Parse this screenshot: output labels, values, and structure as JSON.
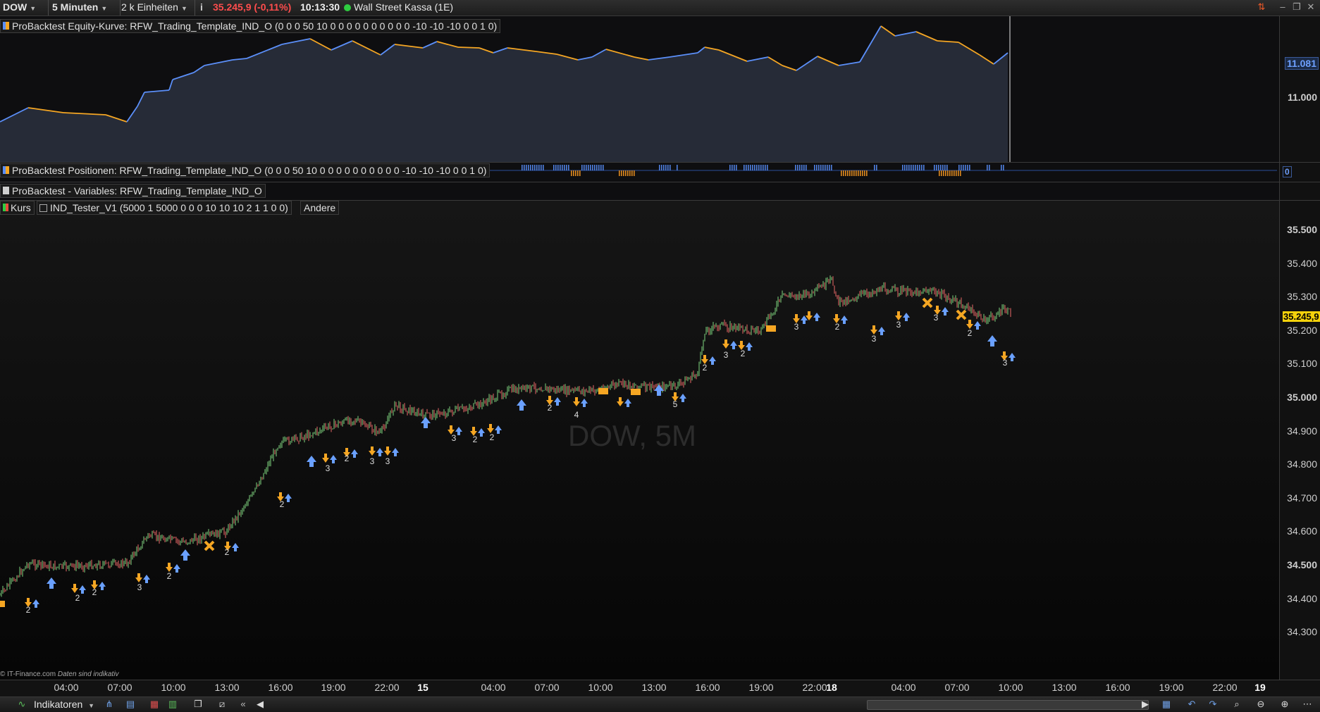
{
  "toolbar": {
    "instrument": "DOW",
    "timeframe": "5 Minuten",
    "units": "2 k Einheiten",
    "info_icon": "info-icon",
    "price_change": "35.245,9 (-0,11%)",
    "time": "10:13:30",
    "market_name": "Wall Street Kassa (1E)"
  },
  "equity_panel": {
    "label": "ProBacktest Equity-Kurve: RFW_Trading_Template_IND_O (0 0 0 50 10 0 0 0 0 0 0 0 0 0 0 -10 -10 -10 0 0 1 0)",
    "axis_ticks": [
      "11.081",
      "11.000"
    ],
    "line_colors": {
      "rising": "#5b8ff9",
      "falling": "#f5a623",
      "fill": "#3a4458"
    }
  },
  "positions_panel": {
    "label": "ProBacktest Positionen: RFW_Trading_Template_IND_O (0 0 0 50 10 0 0 0 0 0 0 0 0 0 0 -10 -10 -10 0 0 1 0)",
    "axis_value": "0",
    "colors": {
      "long": "#4f7fe0",
      "short": "#e08a1e"
    }
  },
  "variables_panel": {
    "label": "ProBacktest - Variables: RFW_Trading_Template_IND_O"
  },
  "price_panel": {
    "kurs_label": "Kurs",
    "indicator_label": "IND_Tester_V1 (5000 1 5000 0 0 0 10 10 10 2 1 1 0 0)",
    "andere_label": "Andere",
    "watermark": "DOW, 5M",
    "current_price": "35.245,9",
    "axis_ticks": [
      "35.500",
      "35.400",
      "35.300",
      "35.200",
      "35.100",
      "35.000",
      "34.900",
      "34.800",
      "34.700",
      "34.600",
      "34.500",
      "34.400",
      "34.300"
    ],
    "footer_copyright": "© IT-Finance.com",
    "footer_note": "Daten sind indikativ",
    "signal_labels": [
      "2",
      "2",
      "2",
      "3",
      "2",
      "2",
      "2",
      "3",
      "2",
      "3",
      "3",
      "3",
      "2",
      "2",
      "2",
      "4",
      "5",
      "2",
      "3",
      "2",
      "3",
      "2",
      "3",
      "3",
      "3",
      "2",
      "3"
    ],
    "colors": {
      "long_signal": "#6aa0ff",
      "short_signal": "#f5a623",
      "current_price_bg": "#f5d20b"
    }
  },
  "time_axis": {
    "ticks": [
      "04:00",
      "07:00",
      "10:00",
      "13:00",
      "16:00",
      "19:00",
      "22:00",
      "15",
      "04:00",
      "07:00",
      "10:00",
      "13:00",
      "16:00",
      "19:00",
      "22:00",
      "18",
      "04:00",
      "07:00",
      "10:00",
      "13:00",
      "16:00",
      "19:00",
      "22:00",
      "19"
    ]
  },
  "bottombar": {
    "indicators_label": "Indikatoren"
  }
}
